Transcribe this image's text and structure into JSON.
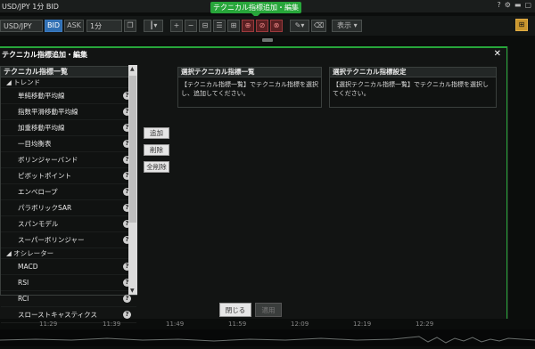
{
  "window": {
    "title": "USD/JPY 1分 BID"
  },
  "tooltip": "テクニカル指標追加・編集",
  "toolbar": {
    "symbol": "USD/JPY",
    "bid": "BID",
    "ask": "ASK",
    "period": "1分",
    "display": "表示"
  },
  "dialog": {
    "title": "テクニカル指標追加・編集",
    "close": "✕",
    "list_header": "テクニカル指標一覧",
    "rows": [
      {
        "label": "◢ トレンド",
        "kind": "cat"
      },
      {
        "label": "単純移動平均線",
        "kind": "item"
      },
      {
        "label": "指数平滑移動平均線",
        "kind": "item"
      },
      {
        "label": "加重移動平均線",
        "kind": "item"
      },
      {
        "label": "一目均衡表",
        "kind": "item"
      },
      {
        "label": "ボリンジャーバンド",
        "kind": "item"
      },
      {
        "label": "ピボットポイント",
        "kind": "item"
      },
      {
        "label": "エンベロープ",
        "kind": "item"
      },
      {
        "label": "パラボリックSAR",
        "kind": "item"
      },
      {
        "label": "スパンモデル",
        "kind": "item"
      },
      {
        "label": "スーパーボリンジャー",
        "kind": "item"
      },
      {
        "label": "◢ オシレーター",
        "kind": "cat"
      },
      {
        "label": "MACD",
        "kind": "item"
      },
      {
        "label": "RSI",
        "kind": "item"
      },
      {
        "label": "RCI",
        "kind": "item"
      },
      {
        "label": "スローストキャスティクス",
        "kind": "item"
      }
    ],
    "add": "追加",
    "remove": "削除",
    "remove_all": "全削除",
    "selected_header": "選択テクニカル指標一覧",
    "selected_body": "【テクニカル指標一覧】でテクニカル指標を選択し、追加してください。",
    "settings_header": "選択テクニカル指標設定",
    "settings_body": "【選択テクニカル指標一覧】でテクニカル指標を選択してください。",
    "close_btn": "閉じる",
    "apply_btn": "適用"
  },
  "timeaxis": [
    "11:29",
    "11:39",
    "11:49",
    "11:59",
    "12:09",
    "12:19",
    "12:29"
  ]
}
